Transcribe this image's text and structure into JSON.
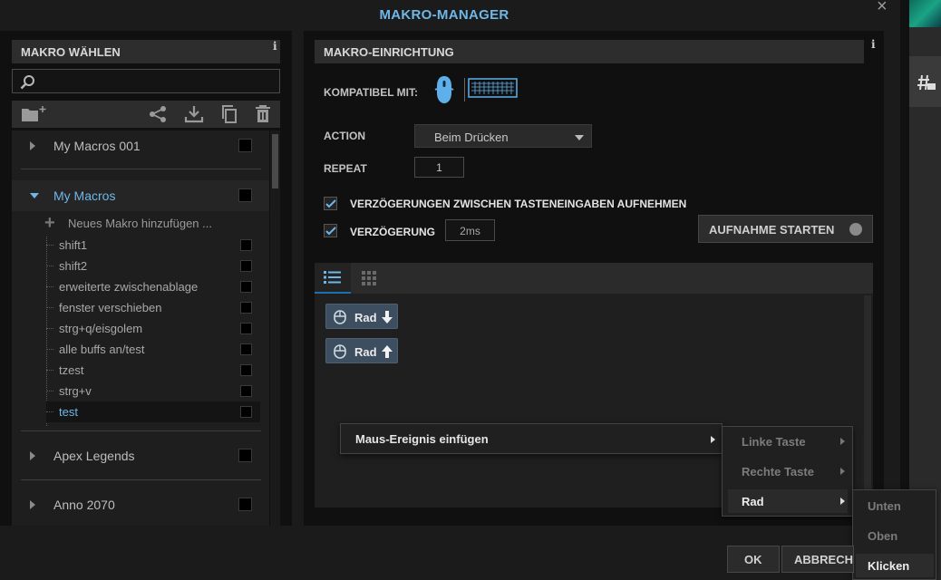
{
  "window": {
    "title": "MAKRO-MANAGER",
    "close_glyph": "×"
  },
  "left_panel": {
    "header": "MAKRO WÄHLEN",
    "info_glyph": "i",
    "search": {
      "value": "",
      "placeholder": ""
    },
    "toolbar_icons": [
      "new-folder-icon",
      "share-icon",
      "import-icon",
      "copy-icon",
      "delete-icon"
    ],
    "groups": [
      {
        "label": "My Macros 001",
        "expanded": false
      },
      {
        "label": "My Macros",
        "expanded": true
      },
      {
        "label": "Apex Legends",
        "expanded": false
      },
      {
        "label": "Anno 2070",
        "expanded": false
      }
    ],
    "add_macro_label": "Neues Makro hinzufügen ...",
    "macros": [
      "shift1",
      "shift2",
      "erweiterte zwischenablage",
      "fenster verschieben",
      "strg+q/eisgolem",
      "alle buffs an/test",
      "tzest",
      "strg+v",
      "test"
    ],
    "selected_macro": "test"
  },
  "main_panel": {
    "header": "MAKRO-EINRICHTUNG",
    "info_glyph": "i",
    "compatible_label": "KOMPATIBEL MIT:",
    "action_label": "ACTION",
    "action_value": "Beim Drücken",
    "repeat_label": "REPEAT",
    "repeat_value": "1",
    "record_delays_label": "VERZÖGERUNGEN ZWISCHEN TASTENEINGABEN AUFNEHMEN",
    "record_delays_checked": true,
    "delay_label": "VERZÖGERUNG",
    "delay_checked": true,
    "delay_value": "2ms",
    "start_recording_label": "AUFNAHME STARTEN",
    "events": [
      {
        "label": "Rad",
        "direction": "down"
      },
      {
        "label": "Rad",
        "direction": "up"
      }
    ]
  },
  "context_menu": {
    "insert_mouse_event": "Maus-Ereignis einfügen",
    "submenu": [
      "Linke Taste",
      "Rechte Taste",
      "Rad"
    ],
    "submenu_active": "Rad",
    "wheel_submenu": [
      "Unten",
      "Oben",
      "Klicken"
    ],
    "wheel_active": "Klicken"
  },
  "footer": {
    "ok_label": "OK",
    "cancel_label": "ABBRECH"
  },
  "colors": {
    "accent": "#6fb7e8",
    "event_chip": "#3c4e5f",
    "panel": "#101010"
  }
}
